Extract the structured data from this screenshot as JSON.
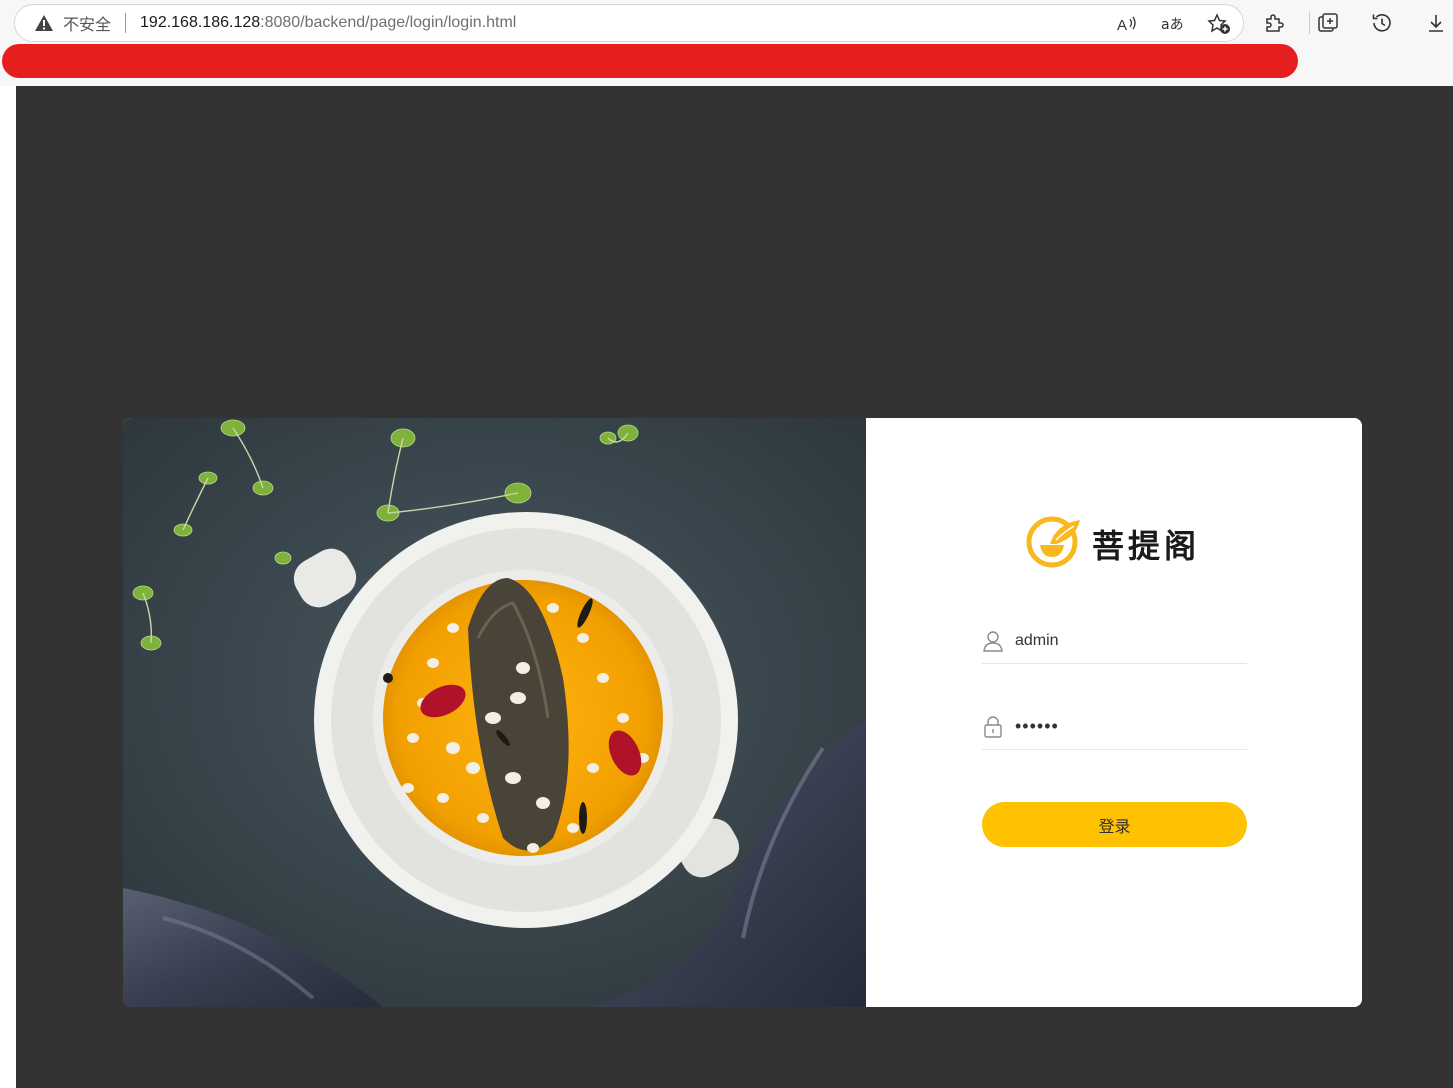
{
  "browser": {
    "security_label": "不安全",
    "url_host": "192.168.186.128",
    "url_rest": ":8080/backend/page/login/login.html",
    "icons": [
      "warning-icon",
      "read-aloud-icon",
      "translate-icon",
      "favorite-add-icon",
      "extensions-icon",
      "collections-icon",
      "history-icon",
      "download-icon"
    ],
    "redaction_color": "#e61e1e"
  },
  "page": {
    "background_color": "#333333"
  },
  "login": {
    "brand_name": "菩提阁",
    "username": {
      "value": "admin",
      "icon": "user-icon"
    },
    "password": {
      "value": "••••••",
      "icon": "lock-icon"
    },
    "submit_label": "登录",
    "accent_color": "#ffc200"
  }
}
